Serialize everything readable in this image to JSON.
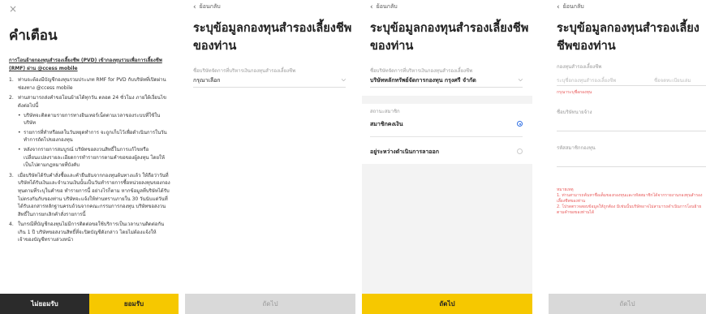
{
  "warning": {
    "close": "×",
    "title": "คำเตือน",
    "lead": "การโอนย้ายกองทุนสำรองเลี้ยงชีพ (PVD) เข้ากองทุนรวมเพื่อการเลี้ยงชีพ (RMF) ผ่าน @ccess mobile",
    "items": [
      {
        "n": "1.",
        "text": "ท่านจะต้องมีบัญชีกองทุนรวมประเภท RMF for PVD กับบริษัทที่เปิดผ่านช่องทาง @ccess mobile"
      },
      {
        "n": "2.",
        "text": "ท่านสามารถส่งคำขอโอนย้ายได้ทุกวัน ตลอด 24 ชั่วโมง ภายใต้เงื่อนไขดังต่อไปนี้"
      }
    ],
    "bullets": [
      "บริษัทจะติดตามรายการทางอินเทอร์เน็ตตามเวลาของระบบที่ใช้ในบริษัท",
      "รายการที่ทำหรือผลในวันหยุดทำการ จะถูกเก็บไว้เพื่อดำเนินการในวันทำการถัดไปของกองทุน",
      "หลังจากรายการสมบูรณ์ บริษัทขอสงวนสิทธิ์ในการแก้ไขหรือเปลี่ยนแปลงรายละเอียดการทำรายการตามคำขอของผู้ลงทุน โดยให้เป็นไปตามกฎหมายที่บังคับ"
    ],
    "items2": [
      {
        "n": "3.",
        "text": "เมื่อบริษัทได้รับคำสั่งซื้อและคำยืนยันจากกองทุนต้นทางแล้ว ให้ถือว่าวันที่บริษัทได้รับเงินและจำนวนเงินนั้นเป็นวันทำรายการซื้อหน่วยลงทุนของกองทุนตามที่ระบุในคำขอ ทำรายการนี้ อย่างไรก็ตาม หากข้อมูลที่บริษัทได้รับไม่ตรงกันกับของท่าน บริษัทจะแจ้งให้ท่านทราบภายใน 30 วันนับแต่วันที่ได้รับเอกสารหลักฐานครบถ้วนจากคณะกรรมการกองทุน บริษัทขอสงวนสิทธิ์ในการยกเลิกคำสั่งรายการนี้"
      },
      {
        "n": "4.",
        "text": "ในกรณีที่บัญชีกองทุนไม่มีการติดต่อขอใช้บริการเป็นเวลานานติดต่อกันเกิน 1 ปี บริษัทขอสงวนสิทธิ์ที่จะปิดบัญชีดังกล่าว โดยไม่ต้องแจ้งให้เจ้าของบัญชีทราบล่วงหน้า"
      }
    ],
    "decline": "ไม่ยอมรับ",
    "accept": "ยอมรับ"
  },
  "form": {
    "back": "ย้อนกลับ",
    "title": "ระบุข้อมูลกองทุนสำรองเลี้ยงชีพของท่าน",
    "company_label": "ชื่อบริษัทจัดการที่บริหารเงินกองทุนสำรองเลี้ยงชีพ",
    "company_placeholder": "กรุณาเลือก",
    "company_selected": "บริษัทหลักทรัพย์จัดการกองทุน กรุงศรี จำกัด",
    "status_label": "สถานะสมาชิก",
    "status_options": [
      "สมาชิกคงเงิน",
      "อยู่ระหว่างดำเนินการลาออก"
    ],
    "next": "ถัดไป"
  },
  "form2": {
    "fund_label": "กองทุนสำรองเลี้ยงชีพ",
    "fund_placeholder": "ระบุชื่อกองทุนสำรองเลี้ยงชีพ",
    "fund_placeholder2": "ชื่อจดทะเบียนเล่ม",
    "fund_error": "กรุณาระบุชื่อกองทุน",
    "employer_label": "ชื่อบริษัทนายจ้าง",
    "member_label": "รหัสสมาชิกกองทุน",
    "note_title": "หมายเหตุ",
    "note_1": "1. ท่านสามารถค้นหาชื่อเต็มของกองทุนและรหัสสมาชิกได้จากรายงานกองทุนสำรองเลี้ยงชีพของท่าน",
    "note_2": "2. โปรดตรวจสอบข้อมูลให้ถูกต้อง มิเช่นนั้นบริษัทอาจไม่สามารถดำเนินการโอนย้ายตามคำขอของท่านได้"
  }
}
